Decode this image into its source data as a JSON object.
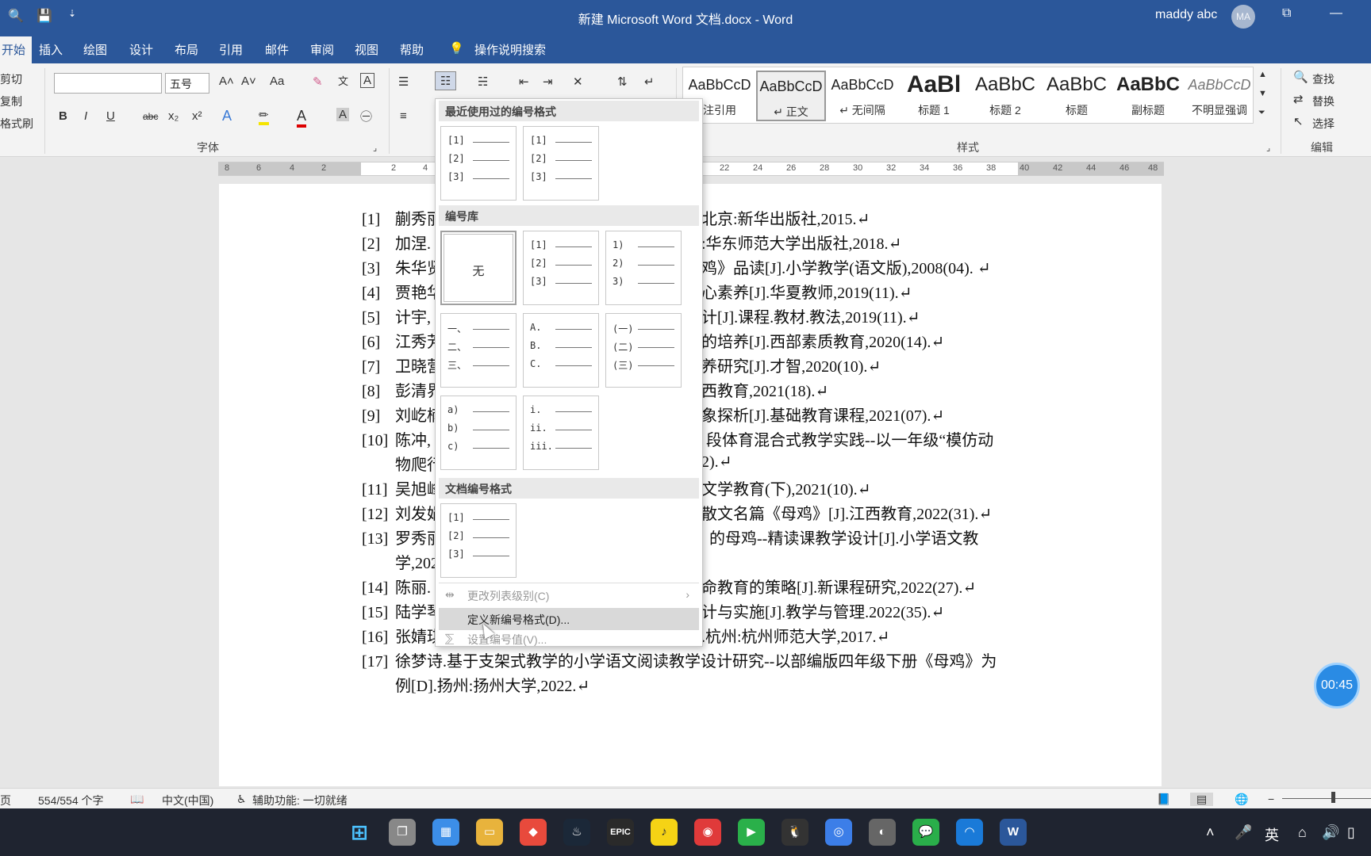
{
  "window": {
    "title": "新建 Microsoft Word 文档.docx  -  Word",
    "user": "maddy abc",
    "avatar_initials": "MA",
    "qa_save": "💾",
    "qa_search": "🔍",
    "qa_more": "⇣",
    "win_restore": "⧉",
    "win_minimize": "—"
  },
  "menu": {
    "active_tab": "开始",
    "tabs": [
      "插入",
      "绘图",
      "设计",
      "布局",
      "引用",
      "邮件",
      "审阅",
      "视图",
      "帮助"
    ],
    "tell_me": "操作说明搜索"
  },
  "ribbon": {
    "clipboard": [
      "剪切",
      "复制",
      "格式刷"
    ],
    "font_name": "",
    "font_size": "五号",
    "font_group_label": "字体",
    "styles_group_label": "样式",
    "editing_group_label": "编辑",
    "editing": [
      "查找",
      "替换",
      "选择"
    ],
    "styles": [
      {
        "sample": "AaBbCcD",
        "name": "注引用"
      },
      {
        "sample": "AaBbCcD",
        "name": "↵ 正文"
      },
      {
        "sample": "AaBbCcD",
        "name": "↵ 无间隔"
      },
      {
        "sample": "AaBl",
        "name": "标题 1"
      },
      {
        "sample": "AaBbC",
        "name": "标题 2"
      },
      {
        "sample": "AaBbC",
        "name": "标题"
      },
      {
        "sample": "AaBbC",
        "name": "副标题"
      },
      {
        "sample": "AaBbCcD",
        "name": "不明显强调"
      }
    ],
    "font_buttons": [
      "B",
      "I",
      "U",
      "abc",
      "x₂",
      "x²",
      "A",
      "Aa"
    ]
  },
  "ruler": {
    "labels": [
      "8",
      "6",
      "4",
      "2",
      "2",
      "4",
      "22",
      "24",
      "26",
      "28",
      "30",
      "32",
      "34",
      "36",
      "38",
      "40",
      "42",
      "44",
      "46",
      "48"
    ]
  },
  "document": {
    "references": [
      {
        "num": "[1]",
        "left": "蒯秀丽",
        "right": "北京:新华出版社,2015.↵"
      },
      {
        "num": "[2]",
        "left": "加涅.",
        "right": ":华东师范大学出版社,2018.↵"
      },
      {
        "num": "[3]",
        "left": "朱华贤",
        "right": "鸡》品读[J].小学教学(语文版),2008(04).  ↵"
      },
      {
        "num": "[4]",
        "left": "贾艳华",
        "right": "心素养[J].华夏教师,2019(11).↵"
      },
      {
        "num": "[5]",
        "left": "计宇,",
        "right": "计[J].课程.教材.教法,2019(11).↵"
      },
      {
        "num": "[6]",
        "left": "江秀芳",
        "right": "的培养[J].西部素质教育,2020(14).↵"
      },
      {
        "num": "[7]",
        "left": "卫晓营",
        "right": "养研究[J].才智,2020(10).↵"
      },
      {
        "num": "[8]",
        "left": "彭清界",
        "right": "西教育,2021(18).↵"
      },
      {
        "num": "[9]",
        "left": "刘屹楠",
        "right": "象探析[J].基础教育课程,2021(07).↵"
      },
      {
        "num": "[10]",
        "left": "陈冲,",
        "right": "段体育混合式教学实践--以一年级“模仿动"
      },
      {
        "num": "",
        "left": "物爬行",
        "right": "2).↵"
      },
      {
        "num": "[11]",
        "left": "吴旭峰",
        "right": "文学教育(下),2021(10).↵"
      },
      {
        "num": "[12]",
        "left": "刘发娟",
        "right": "散文名篇《母鸡》[J].江西教育,2022(31).↵"
      },
      {
        "num": "[13]",
        "left": "罗秀丽",
        "right": "的母鸡--精读课教学设计[J].小学语文教"
      },
      {
        "num": "",
        "left": "学,202",
        "right": ""
      },
      {
        "num": "[14]",
        "left": "陈丽.",
        "right": "命教育的策略[J].新课程研究,2022(27).↵"
      },
      {
        "num": "[15]",
        "left": "陆学琴",
        "right": "计与实施[J].教学与管理.2022(35).↵"
      },
      {
        "num": "[16]",
        "left": "张婧琪",
        "right": ".杭州:杭州师范大学,2017.↵"
      },
      {
        "num": "[17]",
        "left": "徐梦诗.基于支架式教学的小学语文阅读教学设计研究--以部编版四年级下册《母鸡》为",
        "right": ""
      },
      {
        "num": "",
        "left": "例[D].扬州:扬州大学,2022.↵",
        "right": ""
      }
    ]
  },
  "numbering_dropdown": {
    "recent_header": "最近使用过的编号格式",
    "library_header": "编号库",
    "doc_header": "文档编号格式",
    "none_label": "无",
    "formats": {
      "brackets": [
        "[1]",
        "[2]",
        "[3]"
      ],
      "paren_right": [
        "1)",
        "2)",
        "3)"
      ],
      "chinese": [
        "一、",
        "二、",
        "三、"
      ],
      "upper_alpha": [
        "A.",
        "B.",
        "C."
      ],
      "chinese_paren": [
        "(一)",
        "(二)",
        "(三)"
      ],
      "lower_alpha": [
        "a)",
        "b)",
        "c)"
      ],
      "roman": [
        "i.",
        "ii.",
        "iii."
      ]
    },
    "change_level": "更改列表级别(C)",
    "define_new": "定义新编号格式(D)...",
    "set_value": "设置编号值(V)..."
  },
  "statusbar": {
    "page": "页",
    "words": "554/554 个字",
    "language": "中文(中国)",
    "accessibility": "辅助功能: 一切就绪"
  },
  "timer": "00:45",
  "taskbar": {
    "epic_label": "EPIC",
    "ime": "英"
  }
}
